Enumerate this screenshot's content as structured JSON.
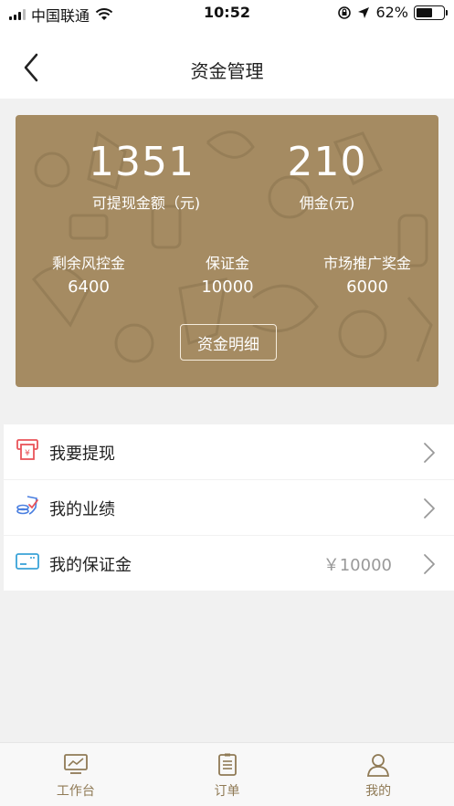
{
  "status_bar": {
    "carrier": "中国联通",
    "time": "10:52",
    "battery": "62%",
    "battery_level": 0.62,
    "icons": [
      "signal-icon",
      "wifi-icon",
      "rotation-lock-icon",
      "location-icon",
      "battery-icon"
    ]
  },
  "nav": {
    "title": "资金管理",
    "back_icon": "chevron-left-icon"
  },
  "card": {
    "withdrawable_value": "1351",
    "withdrawable_label": "可提现金额（元)",
    "commission_value": "210",
    "commission_label": "佣金(元)",
    "stats": [
      {
        "label": "剩余风控金",
        "value": "6400"
      },
      {
        "label": "保证金",
        "value": "10000"
      },
      {
        "label": "市场推广奖金",
        "value": "6000"
      }
    ],
    "detail_button": "资金明细",
    "background_color": "#a58b62"
  },
  "menu": [
    {
      "label": "我要提现",
      "value": "",
      "icon": "withdraw-icon"
    },
    {
      "label": "我的业绩",
      "value": "",
      "icon": "performance-icon"
    },
    {
      "label": "我的保证金",
      "value": "￥10000",
      "icon": "deposit-card-icon"
    }
  ],
  "tabs": [
    {
      "label": "工作台",
      "icon": "workbench-icon"
    },
    {
      "label": "订单",
      "icon": "order-list-icon"
    },
    {
      "label": "我的",
      "icon": "profile-icon"
    }
  ],
  "colors": {
    "accent": "#8f7a55",
    "card": "#a58b62",
    "withdraw_icon": "#e9545a",
    "performance_icon": "#4a7fe0",
    "deposit_icon": "#3aa3d8"
  }
}
